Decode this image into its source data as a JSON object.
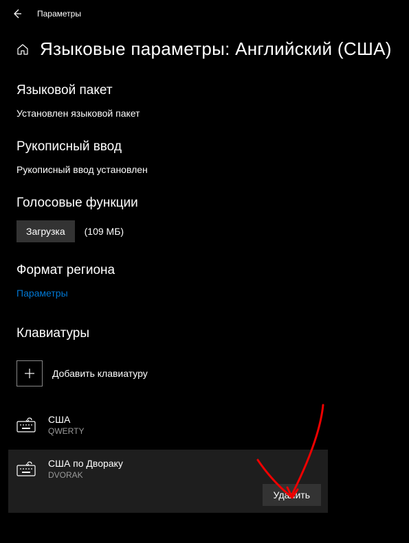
{
  "titlebar": {
    "title": "Параметры"
  },
  "page": {
    "title": "Языковые параметры: Английский (США)"
  },
  "sections": {
    "languagePack": {
      "heading": "Языковой пакет",
      "status": "Установлен языковой пакет"
    },
    "handwriting": {
      "heading": "Рукописный ввод",
      "status": "Рукописный ввод установлен"
    },
    "voice": {
      "heading": "Голосовые функции",
      "downloadLabel": "Загрузка",
      "size": "(109 МБ)"
    },
    "regionFormat": {
      "heading": "Формат региона",
      "link": "Параметры"
    },
    "keyboards": {
      "heading": "Клавиатуры",
      "addLabel": "Добавить клавиатуру",
      "items": [
        {
          "name": "США",
          "layout": "QWERTY"
        },
        {
          "name": "США по Двораку",
          "layout": "DVORAK"
        }
      ],
      "deleteLabel": "Удалить"
    }
  }
}
